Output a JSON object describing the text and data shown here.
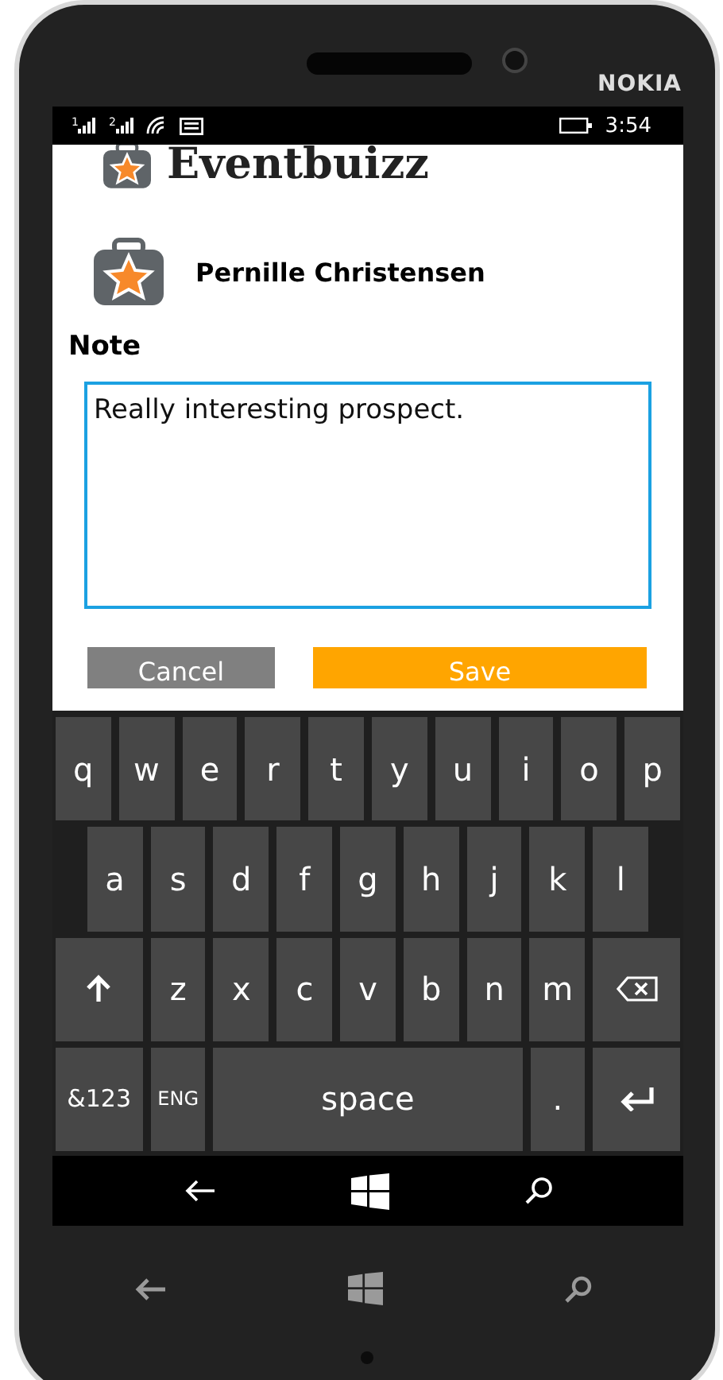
{
  "device": {
    "brand": "NOKIA"
  },
  "status_bar": {
    "sims": [
      "1",
      "2"
    ],
    "time": "3:54"
  },
  "app": {
    "logo_text": "Eventbuizz",
    "contact_name": "Pernille Christensen",
    "note_label": "Note",
    "note_value": "Really interesting prospect.",
    "buttons": [
      {
        "label": "Cancel",
        "kind": "secondary"
      },
      {
        "label": "Save",
        "kind": "primary"
      }
    ]
  },
  "keyboard": {
    "rows": [
      {
        "keys": [
          {
            "kind": "letter",
            "label": "q"
          },
          {
            "kind": "letter",
            "label": "w"
          },
          {
            "kind": "letter",
            "label": "e"
          },
          {
            "kind": "letter",
            "label": "r"
          },
          {
            "kind": "letter",
            "label": "t"
          },
          {
            "kind": "letter",
            "label": "y"
          },
          {
            "kind": "letter",
            "label": "u"
          },
          {
            "kind": "letter",
            "label": "i"
          },
          {
            "kind": "letter",
            "label": "o"
          },
          {
            "kind": "letter",
            "label": "p"
          }
        ]
      },
      {
        "keys": [
          {
            "kind": "letter",
            "label": "a"
          },
          {
            "kind": "letter",
            "label": "s"
          },
          {
            "kind": "letter",
            "label": "d"
          },
          {
            "kind": "letter",
            "label": "f"
          },
          {
            "kind": "letter",
            "label": "g"
          },
          {
            "kind": "letter",
            "label": "h"
          },
          {
            "kind": "letter",
            "label": "j"
          },
          {
            "kind": "letter",
            "label": "k"
          },
          {
            "kind": "letter",
            "label": "l"
          }
        ]
      },
      {
        "keys": [
          {
            "kind": "shift"
          },
          {
            "kind": "letter",
            "label": "z"
          },
          {
            "kind": "letter",
            "label": "x"
          },
          {
            "kind": "letter",
            "label": "c"
          },
          {
            "kind": "letter",
            "label": "v"
          },
          {
            "kind": "letter",
            "label": "b"
          },
          {
            "kind": "letter",
            "label": "n"
          },
          {
            "kind": "letter",
            "label": "m"
          },
          {
            "kind": "backspace"
          }
        ]
      },
      {
        "keys": [
          {
            "kind": "symbols",
            "label": "&123"
          },
          {
            "kind": "language",
            "label": "ENG"
          },
          {
            "kind": "space",
            "label": "space"
          },
          {
            "kind": "letter",
            "label": "."
          },
          {
            "kind": "enter"
          }
        ]
      }
    ]
  }
}
